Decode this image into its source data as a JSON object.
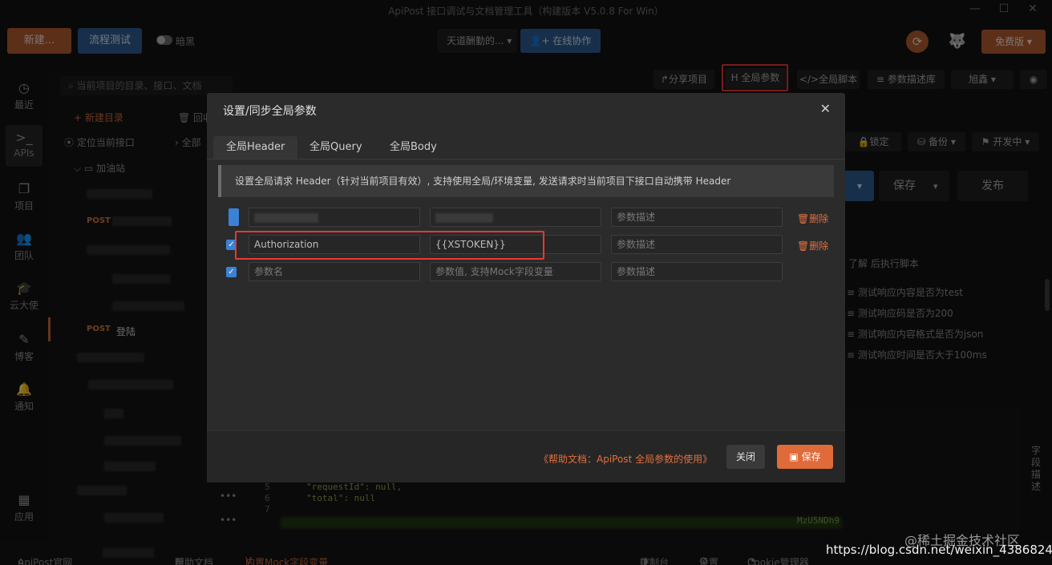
{
  "window": {
    "title": "ApiPost 接口调试与文档管理工具（构建版本 V5.0.8 For Win）",
    "controls": [
      "—",
      "☐",
      "✕"
    ]
  },
  "toolbar": {
    "new_label": "新建...",
    "flow_label": "流程测试",
    "dark_label": "暗黑",
    "team_label": "天道酬勤的... ▾",
    "collab_label": "在线协作",
    "free_label": "免费版 ▾"
  },
  "rail": [
    {
      "icon": "clock-icon",
      "glyph": "◷",
      "label": "最近"
    },
    {
      "icon": "terminal-icon",
      "glyph": ">_",
      "label": "APIs"
    },
    {
      "icon": "project-icon",
      "glyph": "❐",
      "label": "项目"
    },
    {
      "icon": "team-icon",
      "glyph": "👥",
      "label": "团队"
    },
    {
      "icon": "cap-icon",
      "glyph": "🎓",
      "label": "云大使"
    },
    {
      "icon": "blog-icon",
      "glyph": "✎",
      "label": "博客"
    },
    {
      "icon": "bell-icon",
      "glyph": "🔔",
      "label": "通知"
    },
    {
      "icon": "apps-icon",
      "glyph": "▦",
      "label": "应用"
    }
  ],
  "sidebar": {
    "search_placeholder": "当前项目的目录、接口、文档",
    "new_folder": "+ 新建目录",
    "recycle": "回收",
    "locate": "定位当前接口",
    "all": "全部",
    "folder_name": "加油站",
    "post_method": "POST",
    "login_method": "POST",
    "login_name": "登陆"
  },
  "right": {
    "share": "分享项目",
    "global_params": "全局参数",
    "global_script": "全局脚本",
    "param_lib": "参数描述库",
    "user": "旭鑫",
    "lock": "锁定",
    "backup": "备份",
    "dev": "开发中",
    "save": "保存",
    "publish": "发布",
    "learn": "了解 后执行脚本",
    "tests": [
      "测试响应内容是否为test",
      "测试响应码是否为200",
      "测试响应内容格式是否为json",
      "测试响应时间是否大于100ms"
    ],
    "field_desc": "字段描述"
  },
  "code": {
    "lines": [
      {
        "no": "5",
        "text": "\"requestId\": null,"
      },
      {
        "no": "6",
        "text": "\"total\": null"
      },
      {
        "no": "7",
        "text": ""
      }
    ],
    "token_tail": "MzU5NDh9"
  },
  "modal": {
    "title": "设置/同步全局参数",
    "tabs": [
      "全局Header",
      "全局Query",
      "全局Body"
    ],
    "hint": "设置全局请求 Header（针对当前项目有效）, 支持使用全局/环境变量, 发送请求时当前项目下接口自动携带 Header",
    "rows": [
      {
        "name": "",
        "value": "",
        "desc_placeholder": "参数描述",
        "delete": "删除"
      },
      {
        "name": "Authorization",
        "value": "{{XSTOKEN}}",
        "desc_placeholder": "参数描述",
        "delete": "删除"
      },
      {
        "name_placeholder": "参数名",
        "value_placeholder": "参数值, 支持Mock字段变量",
        "desc_placeholder": "参数描述"
      }
    ],
    "help": "《帮助文档：ApiPost 全局参数的使用》",
    "close_label": "关闭",
    "save_label": "保存"
  },
  "statusbar": {
    "official": "ApiPost官网",
    "help": "帮助文档",
    "mock": "内置Mock字段变量",
    "console": "控制台",
    "settings": "设置",
    "cookie": "Cookie管理器"
  },
  "watermark": "@稀土掘金技术社区",
  "url": "https://blog.csdn.net/weixin_43868242"
}
